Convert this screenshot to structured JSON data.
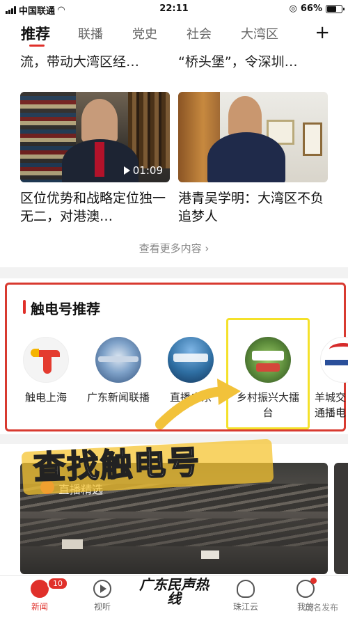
{
  "status_bar": {
    "carrier": "中国联通",
    "time": "22:11",
    "battery": "66%",
    "battery_level": 0.66
  },
  "tabs": [
    {
      "label": "推荐",
      "active": true
    },
    {
      "label": "联播"
    },
    {
      "label": "党史"
    },
    {
      "label": "社会"
    },
    {
      "label": "大湾区"
    }
  ],
  "add_tab_label": "+",
  "top_snippets": [
    "流，带动大湾区经…",
    "“桥头堡”，令深圳…"
  ],
  "video_cards": [
    {
      "title": "区位优势和战略定位独一无二，对港澳…",
      "duration": "01:09"
    },
    {
      "title": "港青吴学明：大湾区不负追梦人"
    }
  ],
  "see_more": "查看更多内容",
  "recommend": {
    "title": "触电号推荐",
    "accounts": [
      {
        "name": "触电上海",
        "color": "#e43b2f"
      },
      {
        "name": "广东新闻联播",
        "color": "#4f7fb5"
      },
      {
        "name": "直播广东",
        "color": "#2f6fa3"
      },
      {
        "name": "乡村振兴大擂台",
        "color": "#5b8a3a"
      },
      {
        "name": "羊城交通播电",
        "color": "#d62b2b"
      }
    ]
  },
  "overlay_text": "查找触电号",
  "feed": {
    "chip_text": "直播精选"
  },
  "bottom_nav": {
    "items": [
      {
        "label": "新闻",
        "badge": "10",
        "active": true
      },
      {
        "label": "视听"
      },
      {
        "label": "珠江云"
      },
      {
        "label": "我的"
      }
    ],
    "center_logo": "广东民声热线"
  },
  "watermark": "茂名发布",
  "colors": {
    "accent": "#e0302a",
    "highlight": "#f4e12a"
  }
}
